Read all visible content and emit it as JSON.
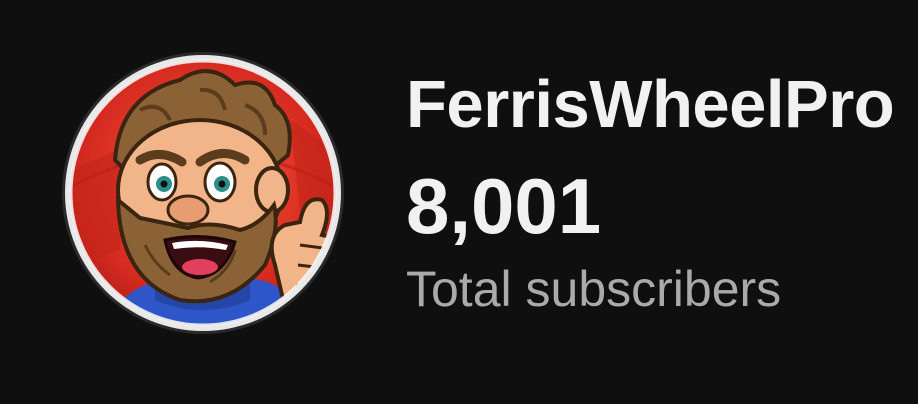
{
  "channel": {
    "name": "FerrisWheelPro",
    "subscriber_count": "8,001",
    "subscriber_label": "Total subscribers",
    "avatar_icon": "bearded-man-thumbs-up-avatar"
  },
  "colors": {
    "background": "#0f0f0f",
    "primary_text": "#f1f1f1",
    "secondary_text": "#aaaaaa",
    "avatar_bg_red": "#d42a20",
    "avatar_ring": "#e8e8e8"
  }
}
